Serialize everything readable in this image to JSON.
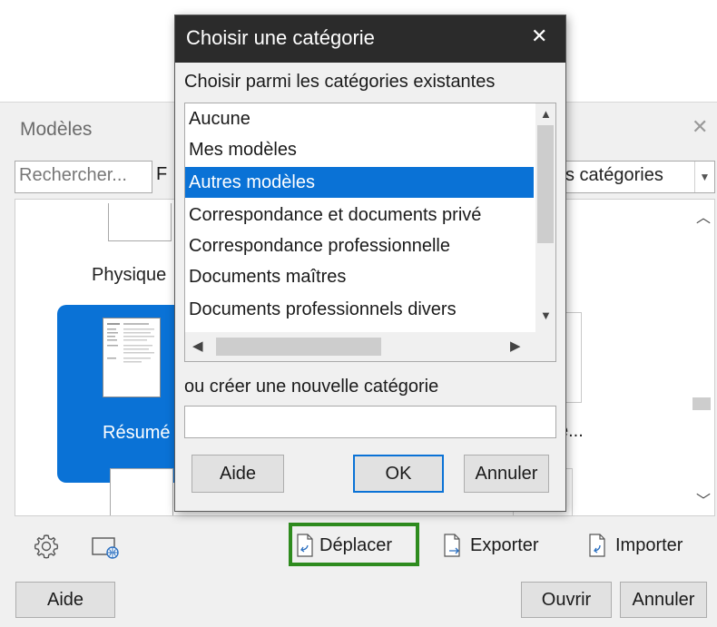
{
  "templates_window": {
    "title": "Modèles",
    "search_placeholder": "Rechercher...",
    "filter_partial": "F",
    "category_select_value": "s catégories",
    "tiles": {
      "label_physique": "Physique",
      "label_resume": "Résumé",
      "label_partial": "e..."
    },
    "toolbar": {
      "move_label": "Déplacer",
      "export_label": "Exporter",
      "import_label": "Importer"
    },
    "buttons": {
      "help": "Aide",
      "open": "Ouvrir",
      "cancel": "Annuler"
    }
  },
  "dialog": {
    "title": "Choisir une catégorie",
    "existing_label": "Choisir parmi les catégories existantes",
    "categories": [
      "Aucune",
      "Mes modèles",
      "Autres modèles",
      "Correspondance et documents privé",
      "Correspondance professionnelle",
      "Documents maîtres",
      "Documents professionnels divers"
    ],
    "selected_category": "Autres modèles",
    "new_label": "ou créer une nouvelle catégorie",
    "new_value": "",
    "buttons": {
      "help": "Aide",
      "ok": "OK",
      "cancel": "Annuler"
    }
  },
  "icons": {
    "close": "close-icon",
    "settings": "gear-icon",
    "online": "web-template-icon",
    "move": "move-document-icon",
    "export": "export-document-icon",
    "import": "import-document-icon"
  },
  "colors": {
    "selection": "#0a72d6",
    "highlight_box": "#2e8b1e",
    "dialog_titlebar": "#2b2b2b"
  }
}
